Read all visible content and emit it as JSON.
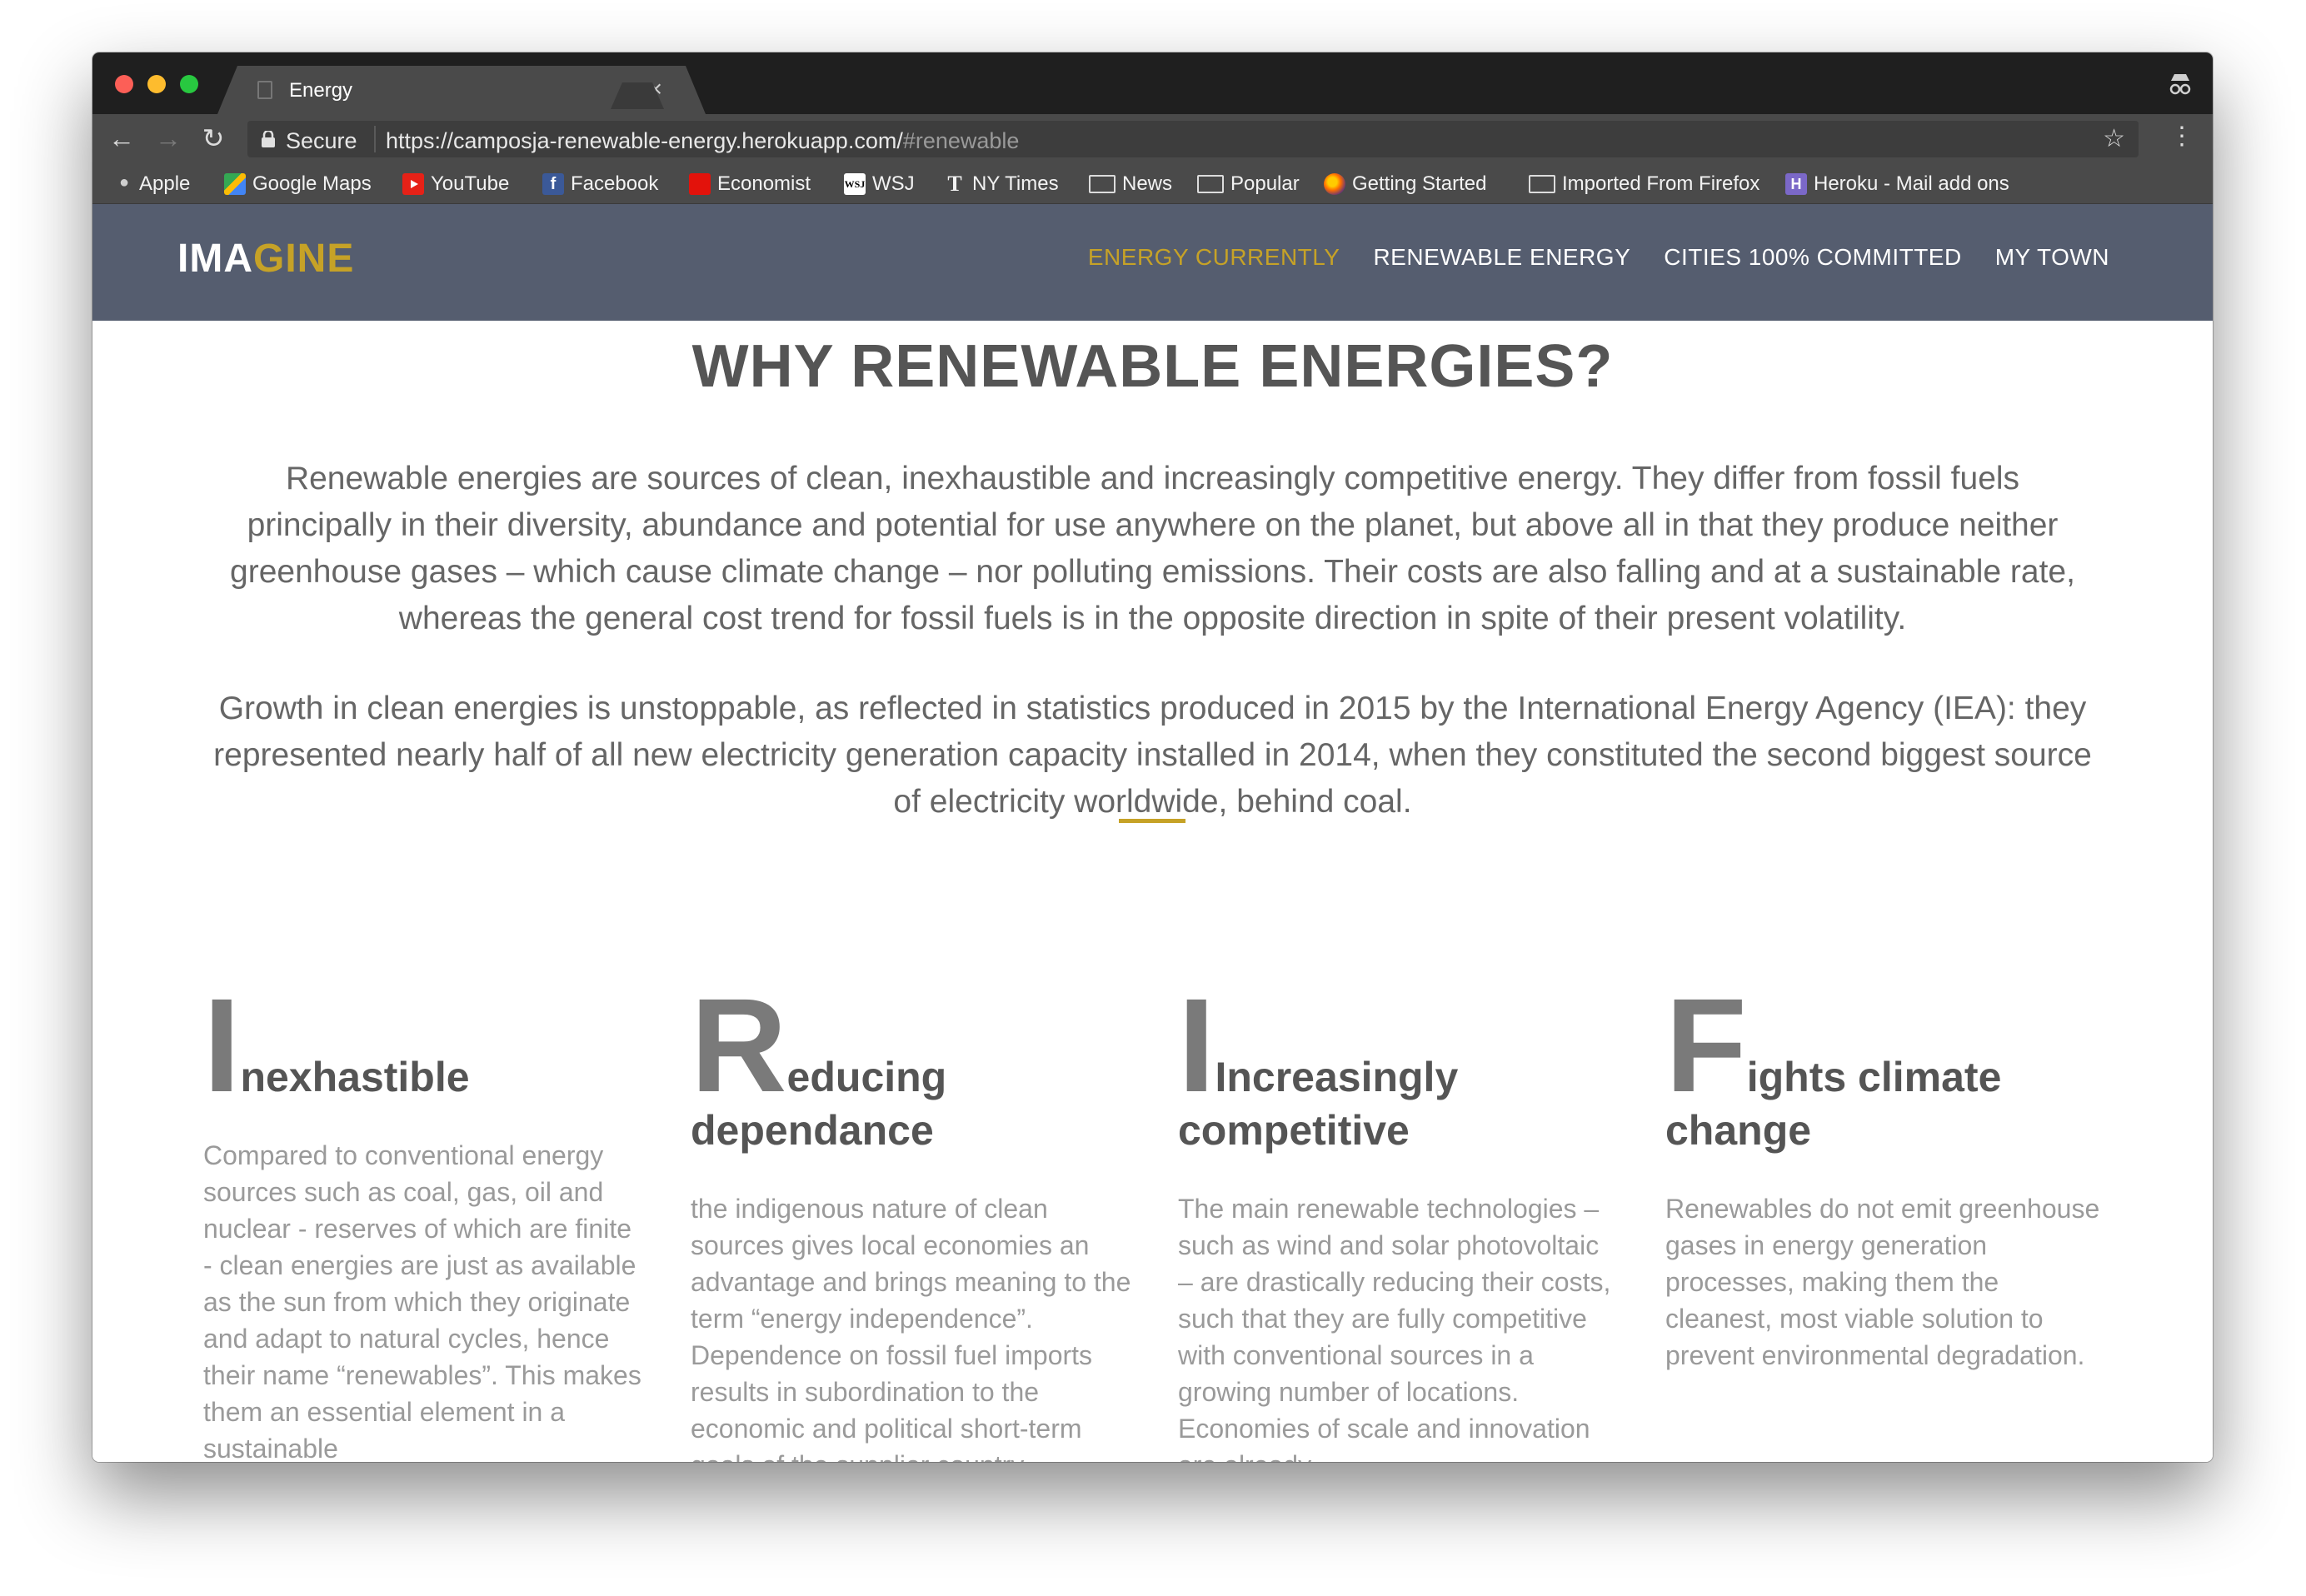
{
  "browser": {
    "tab_title": "Energy",
    "tab_close": "×",
    "secure_label": "Secure",
    "url_main": "https://camposja-renewable-energy.herokuapp.com/",
    "url_hash": "#renewable",
    "bookmarks": [
      {
        "label": "Apple",
        "icon": "apple-icon"
      },
      {
        "label": "Google Maps",
        "icon": "google-maps-icon"
      },
      {
        "label": "YouTube",
        "icon": "youtube-icon"
      },
      {
        "label": "Facebook",
        "icon": "facebook-icon"
      },
      {
        "label": "Economist",
        "icon": "economist-icon"
      },
      {
        "label": "WSJ",
        "icon": "wsj-icon"
      },
      {
        "label": "NY Times",
        "icon": "nytimes-icon"
      },
      {
        "label": "News",
        "icon": "folder-icon"
      },
      {
        "label": "Popular",
        "icon": "folder-icon"
      },
      {
        "label": "Getting Started",
        "icon": "firefox-icon"
      },
      {
        "label": "Imported From Firefox",
        "icon": "folder-icon"
      },
      {
        "label": "Heroku - Mail add ons",
        "icon": "heroku-icon"
      }
    ]
  },
  "site": {
    "logo_part1": "IMA",
    "logo_part2": "GINE",
    "nav": [
      {
        "label": "ENERGY CURRENTLY",
        "active": true
      },
      {
        "label": "RENEWABLE ENERGY",
        "active": false
      },
      {
        "label": "CITIES 100% COMMITTED",
        "active": false
      },
      {
        "label": "MY TOWN",
        "active": false
      }
    ],
    "accent_color": "#c6a227",
    "nav_bg_color": "#555d6f"
  },
  "main": {
    "headline": "WHY RENEWABLE ENERGIES?",
    "paragraph_1": "Renewable energies are sources of clean, inexhaustible and increasingly competitive energy. They differ from fossil fuels principally in their diversity, abundance and potential for use anywhere on the planet, but above all in that they produce neither greenhouse gases – which cause climate change – nor polluting emissions. Their costs are also falling and at a sustainable rate, whereas the general cost trend for fossil fuels is in the opposite direction in spite of their present volatility.",
    "paragraph_2": "Growth in clean energies is unstoppable, as reflected in statistics produced in 2015 by the International Energy Agency (IEA): they represented nearly half of all new electricity generation capacity installed in 2014, when they constituted the second biggest source of electricity worldwide, behind coal."
  },
  "features": [
    {
      "dropcap": "I",
      "title": "nexhastible",
      "body": "Compared to conventional energy sources such as coal, gas, oil and nuclear - reserves of which are finite - clean energies are just as available as the sun from which they originate and adapt to natural cycles, hence their name “renewables”. This makes them an essential element in a sustainable"
    },
    {
      "dropcap": "R",
      "title": "educing dependance",
      "body": "the indigenous nature of clean sources gives local economies an advantage and brings meaning to the term “energy independence”. Dependence on fossil fuel imports results in subordination to the economic and political short-term goals of the supplier country."
    },
    {
      "dropcap": "I",
      "title": "Increasingly competitive",
      "body": "The main renewable technologies – such as wind and solar photovoltaic – are drastically reducing their costs, such that they are fully competitive with conventional sources in a growing number of locations. Economies of scale and innovation are already"
    },
    {
      "dropcap": "F",
      "title": "ights climate change",
      "body": "Renewables do not emit greenhouse gases in energy generation processes, making them the cleanest, most viable solution to prevent environmental degradation."
    }
  ]
}
